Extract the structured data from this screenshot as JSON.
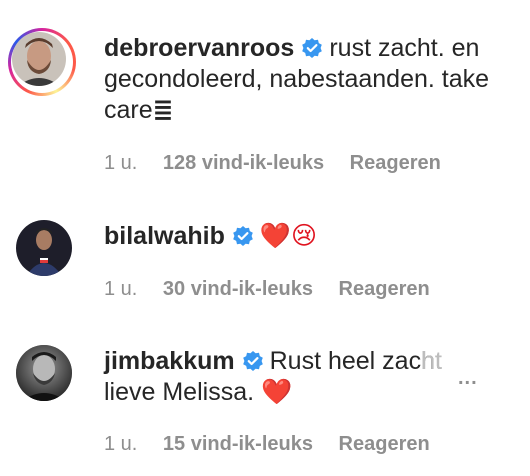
{
  "comments": [
    {
      "username": "debroervanroos",
      "verified": true,
      "text": "rust zacht. en gecondoleerd, nabestaanden. take care",
      "emoji": "≣",
      "time": "1 u.",
      "likes": "128 vind-ik-leuks",
      "reply": "Reageren",
      "has_story_ring": true
    },
    {
      "username": "bilalwahib",
      "verified": true,
      "text": "",
      "emoji": "❤️😢",
      "time": "1 u.",
      "likes": "30 vind-ik-leuks",
      "reply": "Reageren"
    },
    {
      "username": "jimbakkum",
      "verified": true,
      "text_line1": "Rust heel zac",
      "text_fade": "ht",
      "text_line2": "lieve Melissa.",
      "emoji": "❤️",
      "time": "1 u.",
      "likes": "15 vind-ik-leuks",
      "reply": "Reageren",
      "more": "..."
    }
  ],
  "colors": {
    "verified_blue": "#3897f0",
    "meta_gray": "#8e8e8e",
    "text": "#262626",
    "heart": "#e0131f"
  }
}
